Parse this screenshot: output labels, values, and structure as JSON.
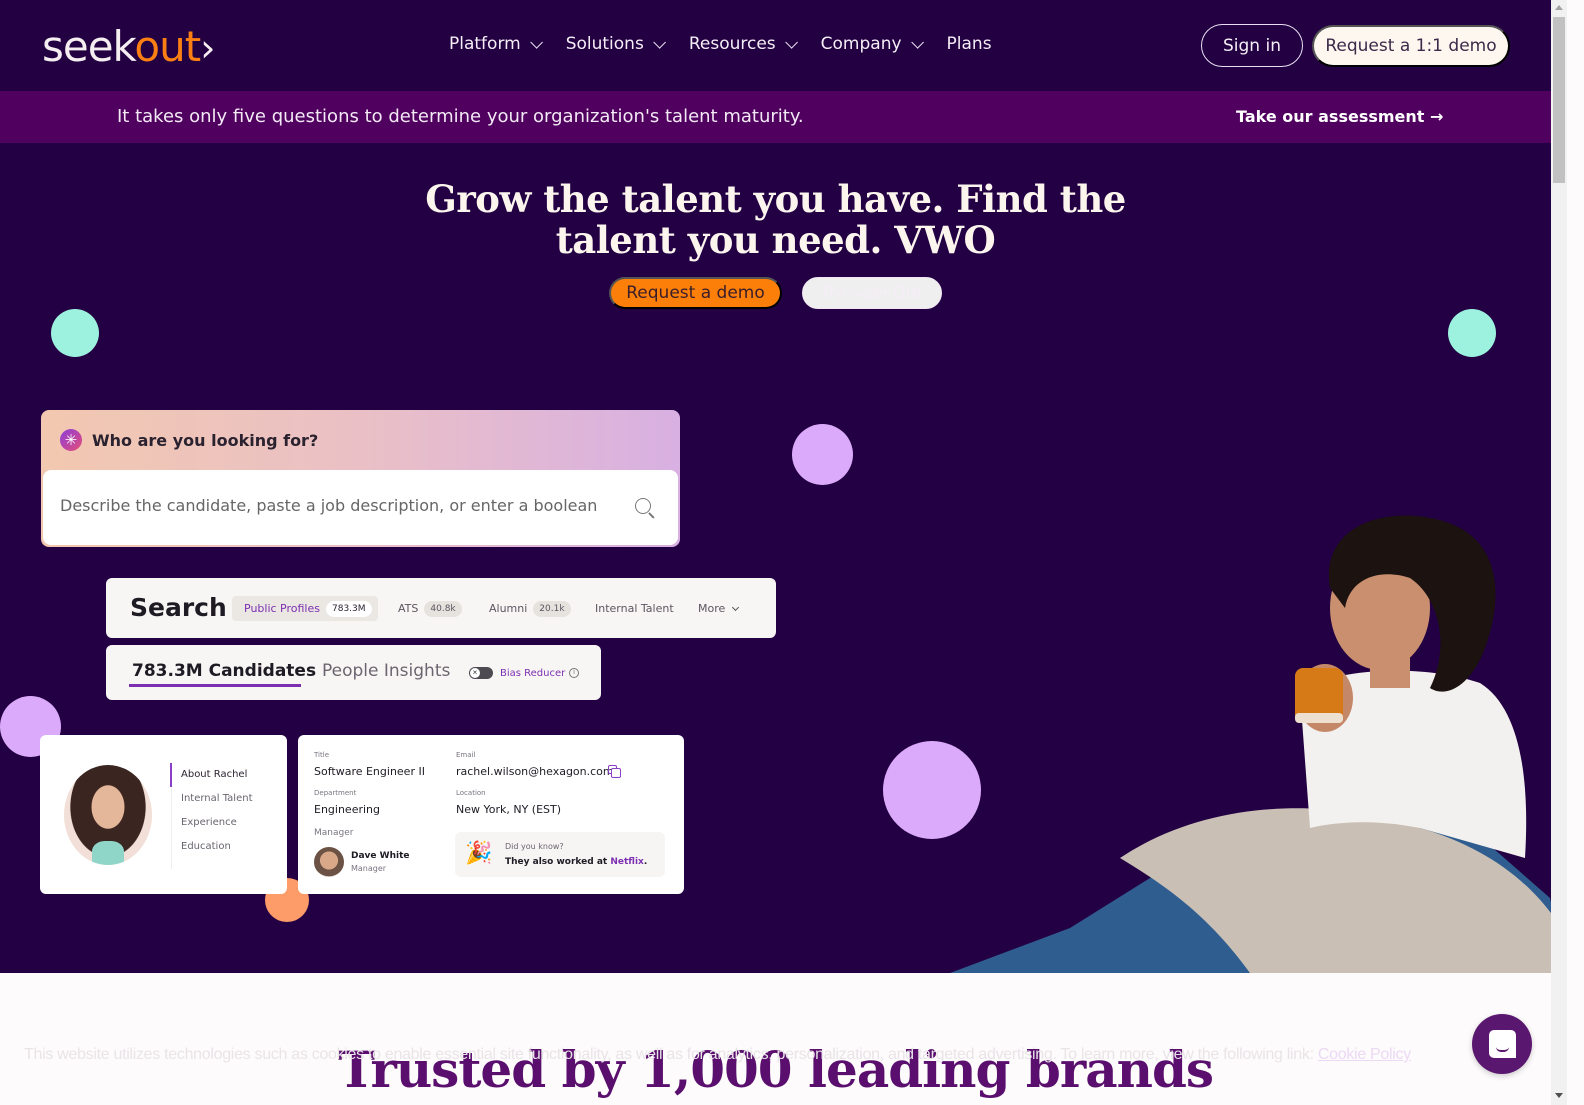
{
  "nav": {
    "logo": {
      "part1": "seek",
      "part2": "out",
      "chevron": "›"
    },
    "links": [
      {
        "label": "Platform",
        "has_dropdown": true
      },
      {
        "label": "Solutions",
        "has_dropdown": true
      },
      {
        "label": "Resources",
        "has_dropdown": true
      },
      {
        "label": "Company",
        "has_dropdown": true
      },
      {
        "label": "Plans",
        "has_dropdown": false
      }
    ],
    "signin_label": "Sign in",
    "demo_label": "Request a 1:1 demo"
  },
  "banner": {
    "text": "It takes only five questions to determine your organization's talent maturity.",
    "link_label": "Take our assessment →"
  },
  "hero": {
    "title_line1": "Grow the talent you have. Find the",
    "title_line2": "talent you need. VWO",
    "primary_button": "Request a demo",
    "secondary_button": "Try SeekOut"
  },
  "search_widget": {
    "prompt_icon": "sparkle-icon",
    "prompt": "Who are you looking for?",
    "placeholder": "Describe the candidate, paste a job description, or enter a boolean",
    "search_icon": "search-icon"
  },
  "search_bar": {
    "title": "Search",
    "segments": [
      {
        "label": "Public Profiles",
        "count": "783.3M",
        "active": true
      },
      {
        "label": "ATS",
        "count": "40.8k",
        "active": false
      },
      {
        "label": "Alumni",
        "count": "20.1k",
        "active": false
      },
      {
        "label": "Internal Talent",
        "count": null,
        "active": false
      },
      {
        "label": "More",
        "count": null,
        "active": false
      }
    ]
  },
  "results_tabs": {
    "candidates_tab": "783.3M Candidates",
    "insights_tab": "People Insights",
    "bias_reducer_label": "Bias Reducer",
    "bias_reducer_on": false,
    "info_glyph": "i"
  },
  "profile": {
    "sections": [
      "About Rachel",
      "Internal Talent",
      "Experience",
      "Education"
    ],
    "active_section": "About Rachel",
    "fields": {
      "title_label": "Title",
      "title_value": "Software Engineer II",
      "email_label": "Email",
      "email_value": "rachel.wilson@hexagon.com",
      "department_label": "Department",
      "department_value": "Engineering",
      "location_label": "Location",
      "location_value": "New York, NY (EST)",
      "manager_label": "Manager",
      "manager_name": "Dave White",
      "manager_role": "Manager"
    },
    "did_you_know": {
      "title": "Did you know?",
      "text_prefix": "They also worked at ",
      "company": "Netflix",
      "text_suffix": "."
    }
  },
  "below_hero": {
    "heading": "Trusted by 1,000 leading brands"
  },
  "cookie_notice": {
    "text": "This website utilizes technologies such as cookies to enable essential site functionality, as well as for analytics, personalization, and targeted advertising. To learn more, view the following link: ",
    "link_label": "Cookie Policy"
  },
  "colors": {
    "nav_bg": "#220042",
    "banner_bg": "#50005f",
    "hero_bg": "#230043",
    "accent_orange": "#fb7f08",
    "accent_purple": "#7c2fb1",
    "mint": "#9cf2de",
    "lilac": "#dcaafb",
    "peach": "#fd9c68"
  }
}
